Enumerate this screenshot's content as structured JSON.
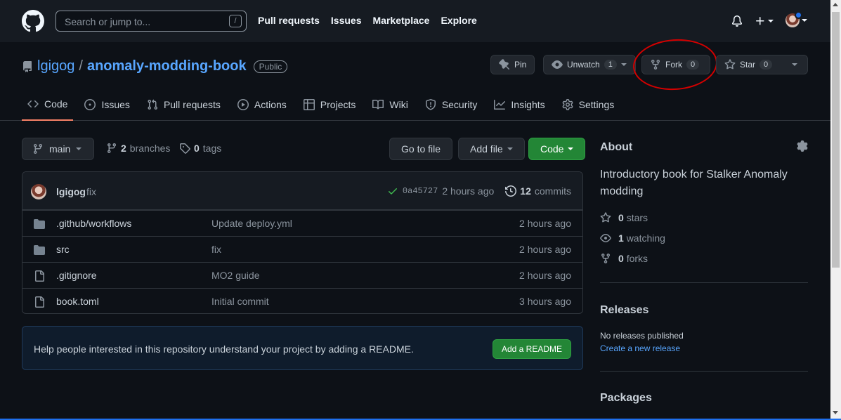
{
  "header": {
    "search_placeholder": "Search or jump to...",
    "search_shortcut": "/",
    "nav": [
      "Pull requests",
      "Issues",
      "Marketplace",
      "Explore"
    ]
  },
  "repo": {
    "owner": "lgigog",
    "separator": "/",
    "name": "anomaly-modding-book",
    "visibility": "Public",
    "pin_label": "Pin",
    "unwatch_label": "Unwatch",
    "unwatch_count": "1",
    "fork_label": "Fork",
    "fork_count": "0",
    "star_label": "Star",
    "star_count": "0"
  },
  "tabs": [
    "Code",
    "Issues",
    "Pull requests",
    "Actions",
    "Projects",
    "Wiki",
    "Security",
    "Insights",
    "Settings"
  ],
  "toolbar": {
    "branch": "main",
    "branches_count": "2",
    "branches_label": "branches",
    "tags_count": "0",
    "tags_label": "tags",
    "go_to_file": "Go to file",
    "add_file": "Add file",
    "code": "Code"
  },
  "commit": {
    "author": "lgigog",
    "message": "fix",
    "sha": "0a45727",
    "time": "2 hours ago",
    "commits_count": "12",
    "commits_label": "commits"
  },
  "files": [
    {
      "type": "folder",
      "name": ".github/workflows",
      "message": "Update deploy.yml",
      "age": "2 hours ago"
    },
    {
      "type": "folder",
      "name": "src",
      "message": "fix",
      "age": "2 hours ago"
    },
    {
      "type": "file",
      "name": ".gitignore",
      "message": "MO2 guide",
      "age": "2 hours ago"
    },
    {
      "type": "file",
      "name": "book.toml",
      "message": "Initial commit",
      "age": "3 hours ago"
    }
  ],
  "readme_prompt": {
    "text": "Help people interested in this repository understand your project by adding a README.",
    "button": "Add a README"
  },
  "about": {
    "heading": "About",
    "description": "Introductory book for Stalker Anomaly modding",
    "stars_count": "0",
    "stars_label": "stars",
    "watching_count": "1",
    "watching_label": "watching",
    "forks_count": "0",
    "forks_label": "forks"
  },
  "releases": {
    "heading": "Releases",
    "none_text": "No releases published",
    "create_link": "Create a new release"
  },
  "packages": {
    "heading": "Packages"
  },
  "colors": {
    "accent_link": "#58a6ff",
    "primary_button": "#238636",
    "annotation_circle": "#d40000"
  }
}
